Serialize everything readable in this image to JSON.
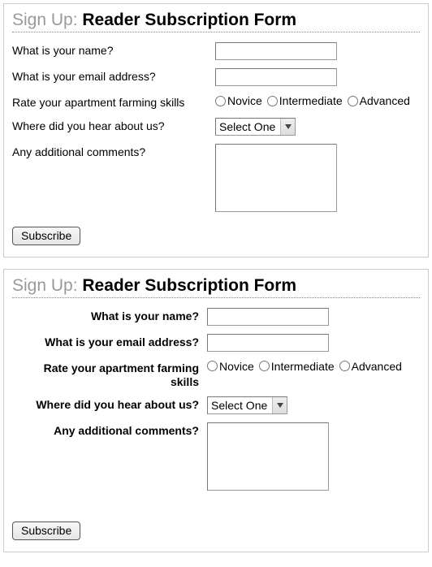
{
  "heading": {
    "lead": "Sign Up: ",
    "title": "Reader Subscription Form"
  },
  "labels": {
    "name": "What is your name?",
    "email": "What is your email address?",
    "skills": "Rate your apartment farming skills",
    "source": "Where did you hear about us?",
    "comments": "Any additional comments?"
  },
  "skill_options": {
    "novice": "Novice",
    "intermediate": "Intermediate",
    "advanced": "Advanced"
  },
  "select_default": "Select One",
  "button": "Subscribe"
}
